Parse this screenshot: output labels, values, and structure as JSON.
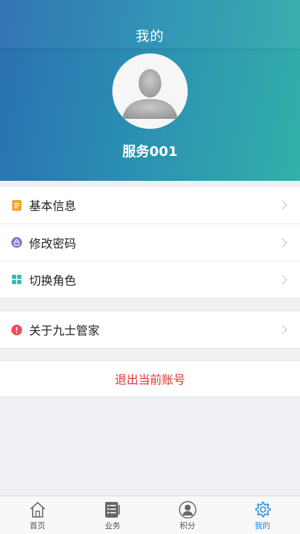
{
  "header": {
    "title": "我的",
    "user_name": "服务001"
  },
  "menu": {
    "group1": [
      {
        "label": "基本信息",
        "icon": "document-icon",
        "color": "#f0a22b"
      },
      {
        "label": "修改密码",
        "icon": "lock-icon",
        "color": "#8e6fd0"
      },
      {
        "label": "切换角色",
        "icon": "grid-icon",
        "color": "#2fb8b0"
      }
    ],
    "group2": [
      {
        "label": "关于九士管家",
        "icon": "alert-icon",
        "color": "#ee4b57"
      }
    ]
  },
  "logout": {
    "label": "退出当前账号",
    "color": "#e0302b"
  },
  "tabbar": {
    "items": [
      {
        "label": "首页",
        "icon": "home-icon"
      },
      {
        "label": "业务",
        "icon": "list-icon"
      },
      {
        "label": "积分",
        "icon": "user-icon"
      },
      {
        "label": "我的",
        "icon": "gear-icon",
        "active": true
      }
    ],
    "active_color": "#1a8be0"
  }
}
